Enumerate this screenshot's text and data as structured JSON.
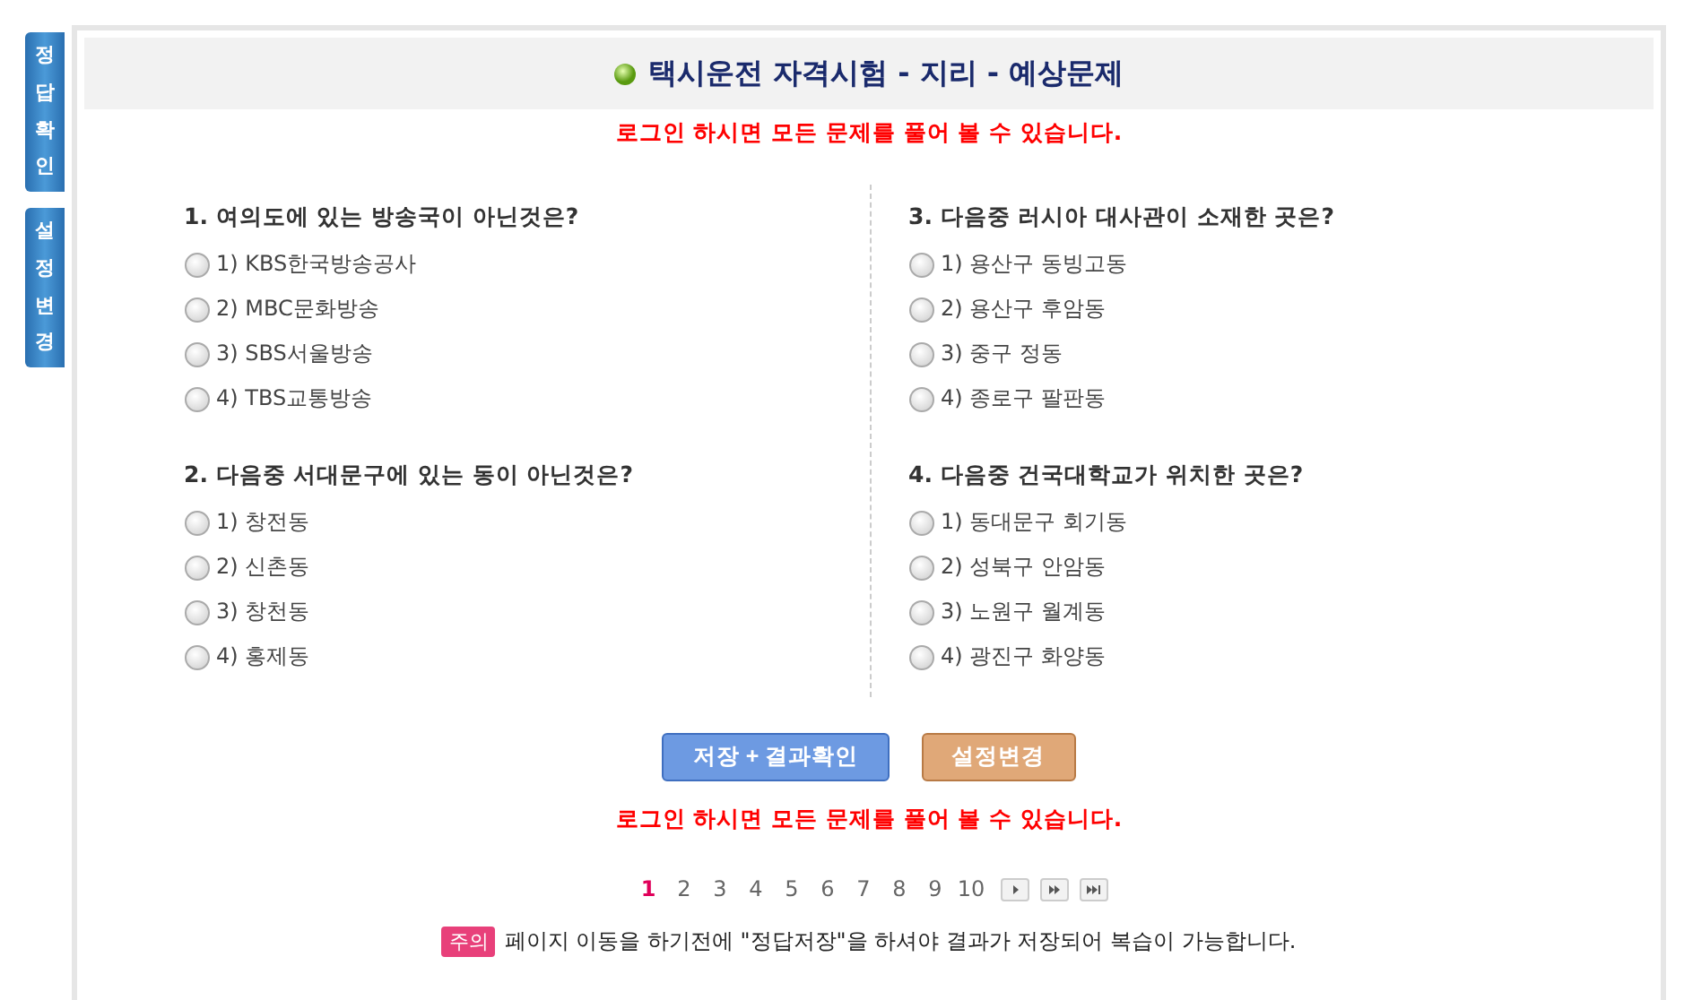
{
  "side_tabs": [
    {
      "label": "정답확인"
    },
    {
      "label": "설정변경"
    }
  ],
  "title": "택시운전 자격시험 - 지리 - 예상문제",
  "notice_top": "로그인 하시면 모든 문제를 풀어 볼 수 있습니다.",
  "columns": [
    {
      "questions": [
        {
          "text": "1. 여의도에 있는 방송국이 아닌것은?",
          "options": [
            {
              "label": "1) KBS한국방송공사",
              "selected": false
            },
            {
              "label": "2) MBC문화방송",
              "selected": false
            },
            {
              "label": "3) SBS서울방송",
              "selected": false
            },
            {
              "label": "4) TBS교통방송",
              "selected": false
            }
          ]
        },
        {
          "text": "2. 다음중 서대문구에 있는 동이 아닌것은?",
          "options": [
            {
              "label": "1) 창전동",
              "selected": false
            },
            {
              "label": "2) 신촌동",
              "selected": false
            },
            {
              "label": "3) 창천동",
              "selected": false
            },
            {
              "label": "4) 홍제동",
              "selected": false
            }
          ]
        }
      ]
    },
    {
      "questions": [
        {
          "text": "3. 다음중 러시아 대사관이 소재한 곳은?",
          "options": [
            {
              "label": "1) 용산구 동빙고동",
              "selected": false
            },
            {
              "label": "2) 용산구 후암동",
              "selected": false
            },
            {
              "label": "3) 중구 정동",
              "selected": false
            },
            {
              "label": "4) 종로구 팔판동",
              "selected": false
            }
          ]
        },
        {
          "text": "4. 다음중 건국대학교가 위치한 곳은?",
          "options": [
            {
              "label": "1) 동대문구 회기동",
              "selected": false
            },
            {
              "label": "2) 성북구 안암동",
              "selected": false
            },
            {
              "label": "3) 노원구 월계동",
              "selected": false
            },
            {
              "label": "4) 광진구 화양동",
              "selected": false
            }
          ]
        }
      ]
    }
  ],
  "buttons": [
    {
      "label": "저장 + 결과확인",
      "kind": "primary"
    },
    {
      "label": "설정변경",
      "kind": "secondary"
    }
  ],
  "notice_bottom": "로그인 하시면 모든 문제를 풀어 볼 수 있습니다.",
  "pagination": {
    "pages": [
      {
        "label": "1",
        "selected": true
      },
      {
        "label": "2",
        "selected": false
      },
      {
        "label": "3",
        "selected": false
      },
      {
        "label": "4",
        "selected": false
      },
      {
        "label": "5",
        "selected": false
      },
      {
        "label": "6",
        "selected": false
      },
      {
        "label": "7",
        "selected": false
      },
      {
        "label": "8",
        "selected": false
      },
      {
        "label": "9",
        "selected": false
      },
      {
        "label": "10",
        "selected": false
      }
    ],
    "nav": [
      {
        "kind": "next"
      },
      {
        "kind": "next_block"
      },
      {
        "kind": "last"
      }
    ]
  },
  "caution": {
    "badge": "주의",
    "text": "페이지 이동을 하기전에 \"정답저장\"을 하셔야 결과가 저장되어 복습이 가능합니다."
  }
}
